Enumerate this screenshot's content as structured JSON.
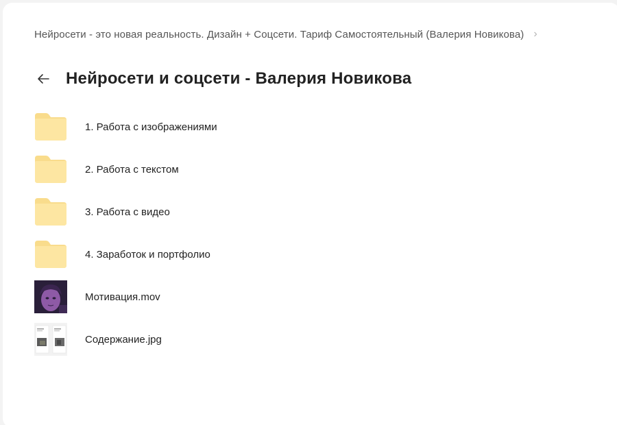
{
  "breadcrumb": {
    "text": "Нейросети - это новая реальность. Дизайн + Соцсети. Тариф Самостоятельный (Валерия Новикова)",
    "chevron": "›"
  },
  "header": {
    "title": "Нейросети и соцсети - Валерия Новикова",
    "back_icon": "arrow-left-icon"
  },
  "colors": {
    "folder": "#fde6a2",
    "folder_tab": "#f9dc8c"
  },
  "items": [
    {
      "type": "folder",
      "icon": "folder-icon",
      "label": "1. Работа с изображениями"
    },
    {
      "type": "folder",
      "icon": "folder-icon",
      "label": "2. Работа с текстом"
    },
    {
      "type": "folder",
      "icon": "folder-icon",
      "label": "3. Работа с видео"
    },
    {
      "type": "folder",
      "icon": "folder-icon",
      "label": "4. Заработок и портфолио"
    },
    {
      "type": "video",
      "icon": "video-thumbnail",
      "label": "Мотивация.mov"
    },
    {
      "type": "image",
      "icon": "image-thumbnail",
      "label": "Содержание.jpg"
    }
  ]
}
